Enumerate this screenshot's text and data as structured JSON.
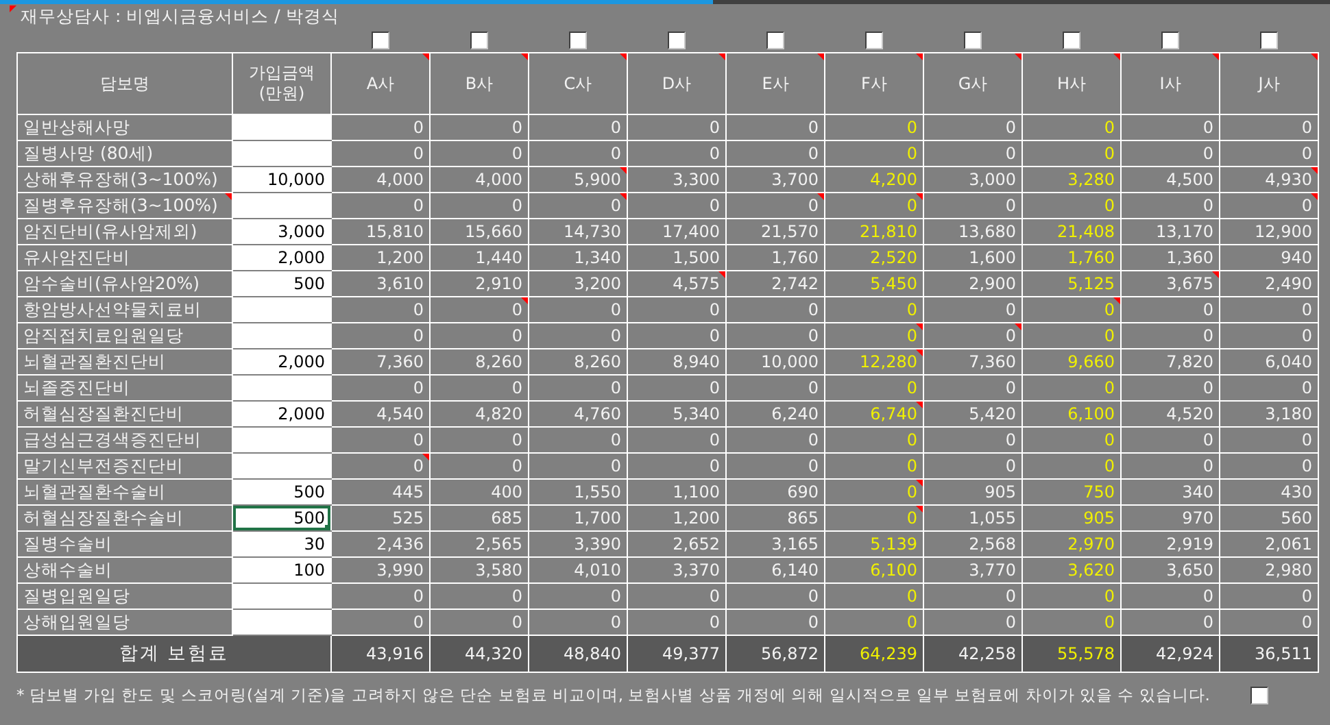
{
  "title": {
    "text": "재무상담사 : 비엡시금융서비스 / 박경식",
    "noted": true
  },
  "columns": {
    "name": "담보명",
    "amount": "가입금액 (만원)"
  },
  "companies": [
    {
      "name": "A사",
      "checked": false,
      "highlight": false,
      "noted": true
    },
    {
      "name": "B사",
      "checked": false,
      "highlight": false,
      "noted": true
    },
    {
      "name": "C사",
      "checked": false,
      "highlight": false,
      "noted": true
    },
    {
      "name": "D사",
      "checked": false,
      "highlight": false,
      "noted": true
    },
    {
      "name": "E사",
      "checked": false,
      "highlight": false,
      "noted": true
    },
    {
      "name": "F사",
      "checked": false,
      "highlight": true,
      "noted": true
    },
    {
      "name": "G사",
      "checked": false,
      "highlight": false,
      "noted": true
    },
    {
      "name": "H사",
      "checked": false,
      "highlight": true,
      "noted": true
    },
    {
      "name": "I사",
      "checked": false,
      "highlight": false,
      "noted": true
    },
    {
      "name": "J사",
      "checked": false,
      "highlight": false,
      "noted": true
    }
  ],
  "rows": [
    {
      "name": "일반상해사망",
      "selected": false,
      "values": [
        "0",
        "0",
        "0",
        "0",
        "0",
        "0",
        "0",
        "0",
        "0",
        "0"
      ],
      "name_noted": false,
      "noted": [
        false,
        false,
        false,
        false,
        false,
        false,
        false,
        false,
        false,
        false
      ]
    },
    {
      "name": "질병사망 (80세)",
      "selected": false,
      "values": [
        "0",
        "0",
        "0",
        "0",
        "0",
        "0",
        "0",
        "0",
        "0",
        "0"
      ],
      "name_noted": false,
      "noted": [
        false,
        false,
        false,
        false,
        false,
        false,
        false,
        false,
        false,
        false
      ]
    },
    {
      "name": "상해후유장해(3~100%)",
      "amount": "10,000",
      "selected": false,
      "values": [
        "4,000",
        "4,000",
        "5,900",
        "3,300",
        "3,700",
        "4,200",
        "3,000",
        "3,280",
        "4,500",
        "4,930"
      ],
      "name_noted": false,
      "noted": [
        false,
        false,
        true,
        false,
        false,
        false,
        false,
        false,
        false,
        true
      ]
    },
    {
      "name": "질병후유장해(3~100%)",
      "selected": false,
      "values": [
        "0",
        "0",
        "0",
        "0",
        "0",
        "0",
        "0",
        "0",
        "0",
        "0"
      ],
      "name_noted": true,
      "noted": [
        false,
        false,
        true,
        false,
        true,
        true,
        false,
        false,
        false,
        true
      ]
    },
    {
      "name": "암진단비(유사암제외)",
      "amount": "3,000",
      "selected": false,
      "values": [
        "15,810",
        "15,660",
        "14,730",
        "17,400",
        "21,570",
        "21,810",
        "13,680",
        "21,408",
        "13,170",
        "12,900"
      ],
      "name_noted": false,
      "noted": [
        false,
        false,
        false,
        false,
        false,
        false,
        false,
        false,
        false,
        false
      ]
    },
    {
      "name": "유사암진단비",
      "amount": "2,000",
      "selected": false,
      "values": [
        "1,200",
        "1,440",
        "1,340",
        "1,500",
        "1,760",
        "2,520",
        "1,600",
        "1,760",
        "1,360",
        "940"
      ],
      "name_noted": false,
      "noted": [
        false,
        false,
        false,
        false,
        false,
        false,
        false,
        false,
        false,
        false
      ]
    },
    {
      "name": "암수술비(유사암20%)",
      "amount": "500",
      "selected": false,
      "values": [
        "3,610",
        "2,910",
        "3,200",
        "4,575",
        "2,742",
        "5,450",
        "2,900",
        "5,125",
        "3,675",
        "2,490"
      ],
      "name_noted": false,
      "noted": [
        false,
        false,
        false,
        true,
        false,
        false,
        false,
        false,
        true,
        false
      ]
    },
    {
      "name": "항암방사선약물치료비",
      "selected": false,
      "values": [
        "0",
        "0",
        "0",
        "0",
        "0",
        "0",
        "0",
        "0",
        "0",
        "0"
      ],
      "name_noted": false,
      "noted": [
        false,
        true,
        false,
        false,
        false,
        false,
        false,
        true,
        false,
        false
      ]
    },
    {
      "name": "암직접치료입원일당",
      "selected": false,
      "values": [
        "0",
        "0",
        "0",
        "0",
        "0",
        "0",
        "0",
        "0",
        "0",
        "0"
      ],
      "name_noted": false,
      "noted": [
        false,
        false,
        false,
        false,
        false,
        true,
        true,
        false,
        false,
        false
      ]
    },
    {
      "name": "뇌혈관질환진단비",
      "amount": "2,000",
      "selected": false,
      "values": [
        "7,360",
        "8,260",
        "8,260",
        "8,940",
        "10,000",
        "12,280",
        "7,360",
        "9,660",
        "7,820",
        "6,040"
      ],
      "name_noted": false,
      "noted": [
        false,
        false,
        false,
        false,
        false,
        true,
        false,
        false,
        false,
        false
      ]
    },
    {
      "name": "뇌졸중진단비",
      "selected": false,
      "values": [
        "0",
        "0",
        "0",
        "0",
        "0",
        "0",
        "0",
        "0",
        "0",
        "0"
      ],
      "name_noted": false,
      "noted": [
        false,
        false,
        false,
        false,
        false,
        false,
        false,
        false,
        false,
        false
      ]
    },
    {
      "name": "허혈심장질환진단비",
      "amount": "2,000",
      "selected": false,
      "values": [
        "4,540",
        "4,820",
        "4,760",
        "5,340",
        "6,240",
        "6,740",
        "5,420",
        "6,100",
        "4,520",
        "3,180"
      ],
      "name_noted": false,
      "noted": [
        false,
        false,
        false,
        false,
        false,
        true,
        false,
        false,
        false,
        false
      ]
    },
    {
      "name": "급성심근경색증진단비",
      "selected": false,
      "values": [
        "0",
        "0",
        "0",
        "0",
        "0",
        "0",
        "0",
        "0",
        "0",
        "0"
      ],
      "name_noted": false,
      "noted": [
        false,
        false,
        false,
        false,
        false,
        false,
        false,
        false,
        false,
        false
      ]
    },
    {
      "name": "말기신부전증진단비",
      "selected": false,
      "values": [
        "0",
        "0",
        "0",
        "0",
        "0",
        "0",
        "0",
        "0",
        "0",
        "0"
      ],
      "name_noted": false,
      "noted": [
        true,
        false,
        false,
        false,
        false,
        false,
        false,
        false,
        false,
        false
      ]
    },
    {
      "name": "뇌혈관질환수술비",
      "amount": "500",
      "selected": false,
      "values": [
        "445",
        "400",
        "1,550",
        "1,100",
        "690",
        "0",
        "905",
        "750",
        "340",
        "430"
      ],
      "name_noted": false,
      "noted": [
        false,
        false,
        false,
        false,
        false,
        true,
        false,
        false,
        false,
        false
      ]
    },
    {
      "name": "허혈심장질환수술비",
      "amount": "500",
      "selected": true,
      "values": [
        "525",
        "685",
        "1,700",
        "1,200",
        "865",
        "0",
        "1,055",
        "905",
        "970",
        "560"
      ],
      "name_noted": false,
      "noted": [
        false,
        false,
        false,
        false,
        false,
        true,
        false,
        false,
        false,
        false
      ]
    },
    {
      "name": "질병수술비",
      "amount": "30",
      "selected": false,
      "values": [
        "2,436",
        "2,565",
        "3,390",
        "2,652",
        "3,165",
        "5,139",
        "2,568",
        "2,970",
        "2,919",
        "2,061"
      ],
      "name_noted": false,
      "noted": [
        false,
        false,
        false,
        false,
        false,
        false,
        false,
        false,
        false,
        false
      ]
    },
    {
      "name": "상해수술비",
      "amount": "100",
      "selected": false,
      "values": [
        "3,990",
        "3,580",
        "4,010",
        "3,370",
        "6,140",
        "6,100",
        "3,770",
        "3,620",
        "3,650",
        "2,980"
      ],
      "name_noted": false,
      "noted": [
        false,
        false,
        false,
        false,
        false,
        false,
        false,
        false,
        false,
        false
      ]
    },
    {
      "name": "질병입원일당",
      "selected": false,
      "values": [
        "0",
        "0",
        "0",
        "0",
        "0",
        "0",
        "0",
        "0",
        "0",
        "0"
      ],
      "name_noted": false,
      "noted": [
        false,
        false,
        false,
        false,
        false,
        false,
        false,
        false,
        false,
        false
      ]
    },
    {
      "name": "상해입원일당",
      "selected": false,
      "values": [
        "0",
        "0",
        "0",
        "0",
        "0",
        "0",
        "0",
        "0",
        "0",
        "0"
      ],
      "name_noted": false,
      "noted": [
        false,
        false,
        false,
        false,
        false,
        false,
        false,
        false,
        false,
        false
      ]
    }
  ],
  "total": {
    "label": "합계 보험료",
    "values": [
      "43,916",
      "44,320",
      "48,840",
      "49,377",
      "56,872",
      "64,239",
      "42,258",
      "55,578",
      "42,924",
      "36,511"
    ]
  },
  "footer": {
    "note": "* 담보별 가입 한도 및 스코어링(설계 기준)을 고려하지 않은 단순 보험료 비교이며, 보험사별 상품 개정에 의해 일시적으로 일부 보험료에 차이가 있을 수 있습니다.",
    "checked": false
  }
}
